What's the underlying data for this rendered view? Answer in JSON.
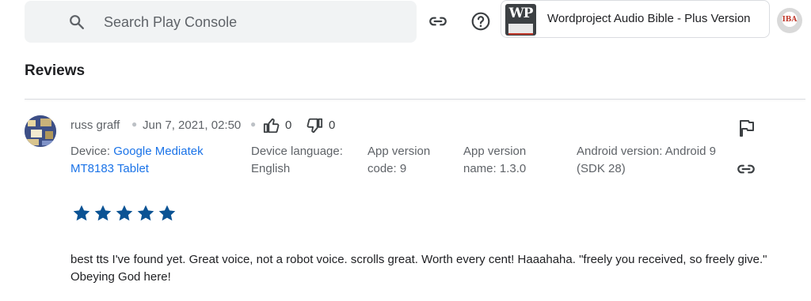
{
  "header": {
    "search_placeholder": "Search Play Console",
    "app_name": "Wordproject Audio Bible - Plus Version",
    "app_logo_text": "WP",
    "avatar_text": "IBA"
  },
  "page": {
    "title": "Reviews"
  },
  "review": {
    "author": "russ graff",
    "date": "Jun 7, 2021, 02:50",
    "thumbs_up": "0",
    "thumbs_down": "0",
    "device_label": "Device:",
    "device_value": "Google Mediatek MT8183 Tablet",
    "language_label": "Device language:",
    "language_value": "English",
    "version_code_label": "App version code:",
    "version_code_value": "9",
    "version_name_label": "App version name:",
    "version_name_value": "1.3.0",
    "android_label": "Android version:",
    "android_value": "Android 9 (SDK 28)",
    "rating": 5,
    "text": "best tts I've found yet. Great voice, not a robot voice. scrolls great. Worth every cent! Haaahaha. \"freely you received, so freely give.\" Obeying God here!"
  },
  "colors": {
    "accent": "#1a73e8",
    "star": "#0b5394",
    "muted": "#5f6368"
  }
}
